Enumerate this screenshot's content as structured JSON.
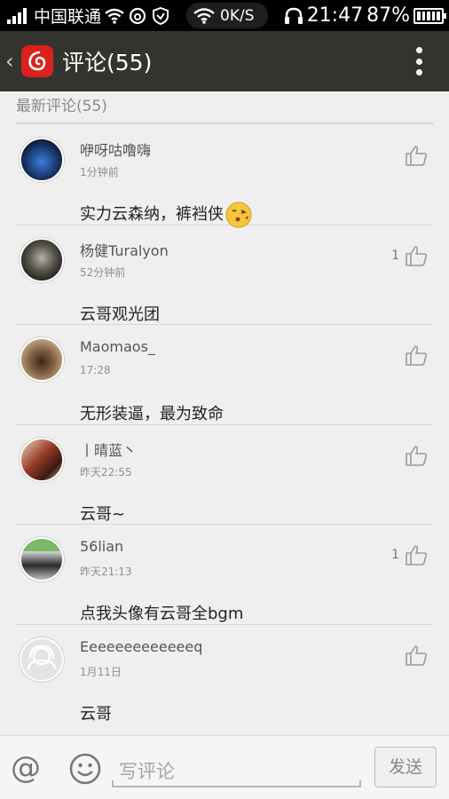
{
  "status_bar": {
    "carrier": "中国联通",
    "speed": "0K/S",
    "time": "21:47",
    "battery": "87%"
  },
  "header": {
    "back_icon": "chevron-left-icon",
    "app_icon": "netease-music-icon",
    "title": "评论(55)",
    "menu_icon": "more-vertical-icon",
    "background": "#333430"
  },
  "section": {
    "title": "最新评论(55)"
  },
  "comments": [
    {
      "username": "咿呀咕噜嗨",
      "time": "1分钟前",
      "text": "实力云森纳，裤裆侠",
      "likes": "",
      "emoji": "kiss-emoji"
    },
    {
      "username": "杨健Turalyon",
      "time": "52分钟前",
      "text": "云哥观光团",
      "likes": "1"
    },
    {
      "username": "Maomaos_",
      "time": "17:28",
      "text": "无形装逼，最为致命",
      "likes": ""
    },
    {
      "username": "丨晴蓝丶",
      "time": "昨天22:55",
      "text": "云哥~",
      "likes": ""
    },
    {
      "username": "56lian",
      "time": "昨天21:13",
      "text": "点我头像有云哥全bgm",
      "likes": "1"
    },
    {
      "username": "Eeeeeeeeeeeeeq",
      "time": "1月11日",
      "text": "云哥",
      "likes": ""
    }
  ],
  "composer": {
    "at_label": "@",
    "placeholder": "写评论",
    "send_label": "发送"
  },
  "colors": {
    "brand_red": "#d9211d",
    "title_bar": "#333430"
  }
}
